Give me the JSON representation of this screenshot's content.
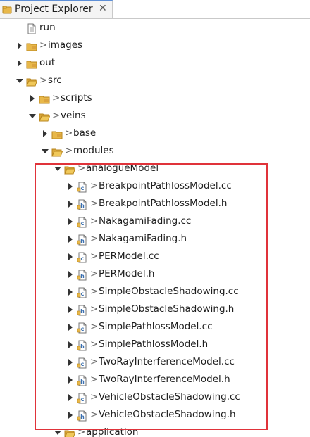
{
  "view": {
    "tab_title": "Project Explorer",
    "close_glyph": "✕"
  },
  "tree": {
    "deco_char": ">",
    "rows": [
      {
        "label": "run",
        "icon": "file-icon",
        "indent": 0,
        "twisty": "none",
        "decorated": false
      },
      {
        "label": "images",
        "icon": "folder-icon",
        "indent": 0,
        "twisty": "collapsed",
        "decorated": true
      },
      {
        "label": "out",
        "icon": "folder-icon",
        "indent": 0,
        "twisty": "collapsed",
        "decorated": false
      },
      {
        "label": "src",
        "icon": "folder-open-icon",
        "indent": 0,
        "twisty": "expanded",
        "decorated": true
      },
      {
        "label": "scripts",
        "icon": "folder-icon",
        "indent": 1,
        "twisty": "collapsed",
        "decorated": true
      },
      {
        "label": "veins",
        "icon": "folder-open-icon",
        "indent": 1,
        "twisty": "expanded",
        "decorated": true
      },
      {
        "label": "base",
        "icon": "folder-icon",
        "indent": 2,
        "twisty": "collapsed",
        "decorated": true
      },
      {
        "label": "modules",
        "icon": "folder-open-icon",
        "indent": 2,
        "twisty": "expanded",
        "decorated": true
      },
      {
        "label": "analogueModel",
        "icon": "folder-open-icon",
        "indent": 3,
        "twisty": "expanded",
        "decorated": true
      },
      {
        "label": "BreakpointPathlossModel.cc",
        "icon": "cc-file-icon",
        "indent": 4,
        "twisty": "collapsed",
        "decorated": true
      },
      {
        "label": "BreakpointPathlossModel.h",
        "icon": "h-file-icon",
        "indent": 4,
        "twisty": "collapsed",
        "decorated": true
      },
      {
        "label": "NakagamiFading.cc",
        "icon": "cc-file-icon",
        "indent": 4,
        "twisty": "collapsed",
        "decorated": true
      },
      {
        "label": "NakagamiFading.h",
        "icon": "h-file-icon",
        "indent": 4,
        "twisty": "collapsed",
        "decorated": true
      },
      {
        "label": "PERModel.cc",
        "icon": "cc-file-icon",
        "indent": 4,
        "twisty": "collapsed",
        "decorated": true
      },
      {
        "label": "PERModel.h",
        "icon": "h-file-icon",
        "indent": 4,
        "twisty": "collapsed",
        "decorated": true
      },
      {
        "label": "SimpleObstacleShadowing.cc",
        "icon": "cc-file-icon",
        "indent": 4,
        "twisty": "collapsed",
        "decorated": true
      },
      {
        "label": "SimpleObstacleShadowing.h",
        "icon": "h-file-icon",
        "indent": 4,
        "twisty": "collapsed",
        "decorated": true
      },
      {
        "label": "SimplePathlossModel.cc",
        "icon": "cc-file-icon",
        "indent": 4,
        "twisty": "collapsed",
        "decorated": true
      },
      {
        "label": "SimplePathlossModel.h",
        "icon": "h-file-icon",
        "indent": 4,
        "twisty": "collapsed",
        "decorated": true
      },
      {
        "label": "TwoRayInterferenceModel.cc",
        "icon": "cc-file-icon",
        "indent": 4,
        "twisty": "collapsed",
        "decorated": true
      },
      {
        "label": "TwoRayInterferenceModel.h",
        "icon": "h-file-icon",
        "indent": 4,
        "twisty": "collapsed",
        "decorated": true
      },
      {
        "label": "VehicleObstacleShadowing.cc",
        "icon": "cc-file-icon",
        "indent": 4,
        "twisty": "collapsed",
        "decorated": true
      },
      {
        "label": "VehicleObstacleShadowing.h",
        "icon": "h-file-icon",
        "indent": 4,
        "twisty": "collapsed",
        "decorated": true
      },
      {
        "label": "application",
        "icon": "folder-open-icon",
        "indent": 3,
        "twisty": "expanded",
        "decorated": true
      }
    ]
  },
  "colors": {
    "highlight": "#e0333a",
    "folder": "#e8b84a",
    "folder_dark": "#b8861e",
    "twisty": "#333333"
  }
}
